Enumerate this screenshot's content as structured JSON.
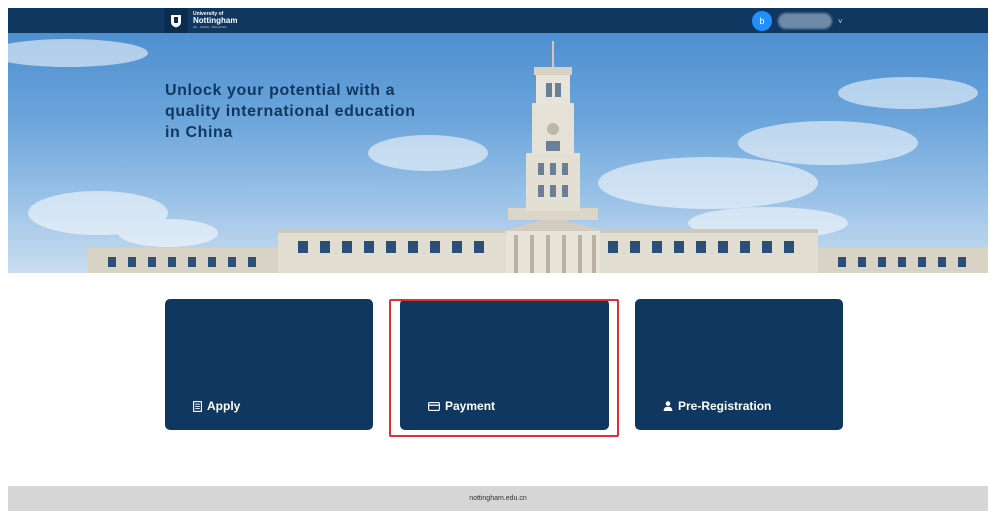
{
  "header": {
    "logo": {
      "line1": "University of",
      "line2": "Nottingham",
      "line3": "UK · CHINA · MALAYSIA"
    },
    "user": {
      "avatar_letter": "b",
      "name": "",
      "caret": "˅"
    }
  },
  "hero": {
    "headline": "Unlock your potential with a quality international education in China"
  },
  "cards": [
    {
      "label": "Apply",
      "icon": "document-icon"
    },
    {
      "label": "Payment",
      "icon": "credit-card-icon"
    },
    {
      "label": "Pre-Registration",
      "icon": "person-icon"
    }
  ],
  "colors": {
    "navy": "#10375f",
    "highlight": "#e03030",
    "avatar": "#1e90ff"
  },
  "footer": {
    "text": "nottingham.edu.cn"
  }
}
